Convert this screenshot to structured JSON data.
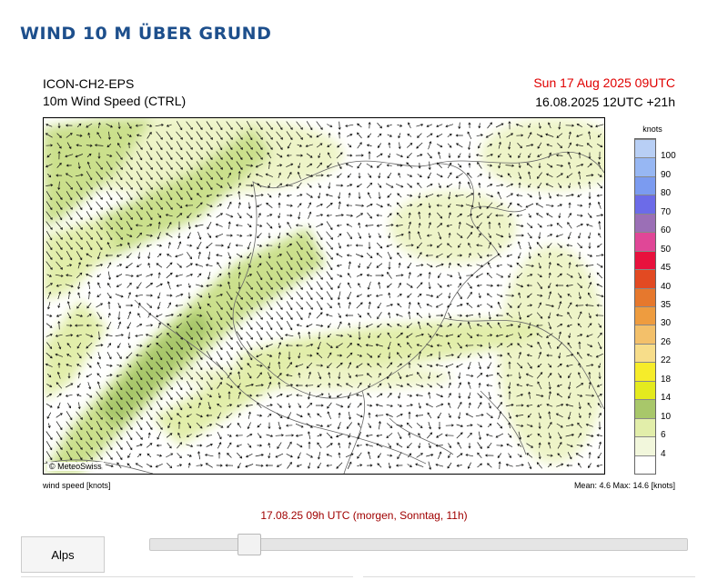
{
  "page": {
    "title": "WIND 10 M ÜBER GRUND"
  },
  "header": {
    "model": "ICON-CH2-EPS",
    "parameter": "10m Wind Speed (CTRL)",
    "valid_time": "Sun 17 Aug 2025 09UTC",
    "run_time": "16.08.2025 12UTC +21h"
  },
  "map": {
    "copyright": "© MeteoSwiss",
    "arrow_icon": "wind-arrow-icon",
    "colors": {
      "light": "#eef4c8",
      "mid": "#e2eeaa",
      "strong": "#cbe08c",
      "stronger": "#a8c76a"
    }
  },
  "legend": {
    "unit": "knots",
    "entries": [
      {
        "label": "100",
        "color": "#b8cff5"
      },
      {
        "label": "90",
        "color": "#97b7f3"
      },
      {
        "label": "80",
        "color": "#7b9bf0"
      },
      {
        "label": "70",
        "color": "#6c6be8"
      },
      {
        "label": "60",
        "color": "#9b6fb6"
      },
      {
        "label": "50",
        "color": "#e04797"
      },
      {
        "label": "45",
        "color": "#e8113d"
      },
      {
        "label": "40",
        "color": "#e24a22"
      },
      {
        "label": "35",
        "color": "#e6782d"
      },
      {
        "label": "30",
        "color": "#ee9c3f"
      },
      {
        "label": "26",
        "color": "#f3c06a"
      },
      {
        "label": "22",
        "color": "#f7dd8a"
      },
      {
        "label": "18",
        "color": "#f6ec2a"
      },
      {
        "label": "14",
        "color": "#e4ea1e"
      },
      {
        "label": "10",
        "color": "#a8c76a"
      },
      {
        "label": "6",
        "color": "#e2eeaa"
      },
      {
        "label": "4",
        "color": "#f2f7dc"
      },
      {
        "label": "",
        "color": "#ffffff"
      }
    ]
  },
  "footer": {
    "left": "wind speed [knots]",
    "right": "Mean:   4.6 Max:  14.6 [knots]"
  },
  "timeline": {
    "label": "17.08.25 09h UTC (morgen, Sonntag, 11h)",
    "position": 0.17
  },
  "region": {
    "button_label": "Alps"
  }
}
